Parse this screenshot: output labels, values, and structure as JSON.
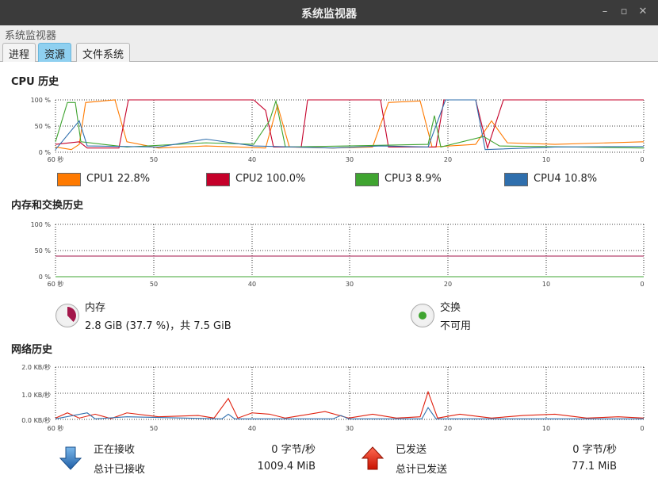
{
  "window": {
    "title": "系统监视器"
  },
  "menubar": {
    "app_name": "系统监视器"
  },
  "tabs": [
    {
      "label": "进程",
      "active": false
    },
    {
      "label": "资源",
      "active": true
    },
    {
      "label": "文件系统",
      "active": false
    }
  ],
  "cpu": {
    "title": "CPU 历史",
    "y_ticks": [
      "100 %",
      "50 %",
      "0 %"
    ],
    "x_ticks": [
      "60 秒",
      "50",
      "40",
      "30",
      "20",
      "10",
      "0"
    ],
    "legend": [
      {
        "label": "CPU1  22.8%",
        "color": "#ff7a00"
      },
      {
        "label": "CPU2  100.0%",
        "color": "#c5002a"
      },
      {
        "label": "CPU3  8.9%",
        "color": "#3fa430"
      },
      {
        "label": "CPU4  10.8%",
        "color": "#2f6fad"
      }
    ]
  },
  "memory": {
    "title": "内存和交换历史",
    "y_ticks": [
      "100 %",
      "50 %",
      "0 %"
    ],
    "x_ticks": [
      "60 秒",
      "50",
      "40",
      "30",
      "20",
      "10",
      "0"
    ],
    "mem_label": "内存",
    "mem_value": "2.8 GiB (37.7 %)，共 7.5 GiB",
    "mem_color": "#a3164a",
    "swap_label": "交换",
    "swap_value": "不可用",
    "swap_color": "#3fa430"
  },
  "network": {
    "title": "网络历史",
    "y_ticks": [
      "2.0 KB/秒",
      "1.0 KB/秒",
      "0.0 KB/秒"
    ],
    "x_ticks": [
      "60 秒",
      "50",
      "40",
      "30",
      "20",
      "10",
      "0"
    ],
    "recv_label": "正在接收",
    "recv_rate": "0 字节/秒",
    "recv_total_label": "总计已接收",
    "recv_total": "1009.4 MiB",
    "send_label": "已发送",
    "send_rate": "0 字节/秒",
    "send_total_label": "总计已发送",
    "send_total": "77.1 MiB",
    "recv_color": "#2f6fad",
    "send_color": "#e0200e"
  }
}
